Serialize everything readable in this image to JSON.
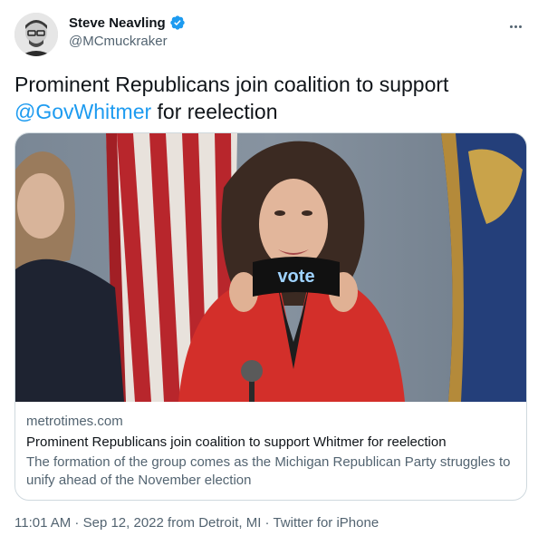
{
  "author": {
    "display_name": "Steve Neavling",
    "handle": "@MCmuckraker",
    "verified": true,
    "avatar_icon": "person-avatar-icon"
  },
  "tweet": {
    "text_before": "Prominent Republicans join coalition to support",
    "mention": "@GovWhitmer",
    "text_after": " for reelection"
  },
  "card": {
    "image_sign_text": "vote",
    "domain": "metrotimes.com",
    "title": "Prominent Republicans join coalition to support Whitmer for reelection",
    "description": "The formation of the group comes as the Michigan Republican Party struggles to unify ahead of the November election"
  },
  "meta": {
    "time": "11:01 AM",
    "sep1": " · ",
    "date": "Sep 12, 2022",
    "location": " from Detroit, MI",
    "sep2": " · ",
    "source": "Twitter for iPhone"
  },
  "colors": {
    "link": "#1d9bf0",
    "secondary_text": "#536471",
    "border": "#cfd9de"
  }
}
